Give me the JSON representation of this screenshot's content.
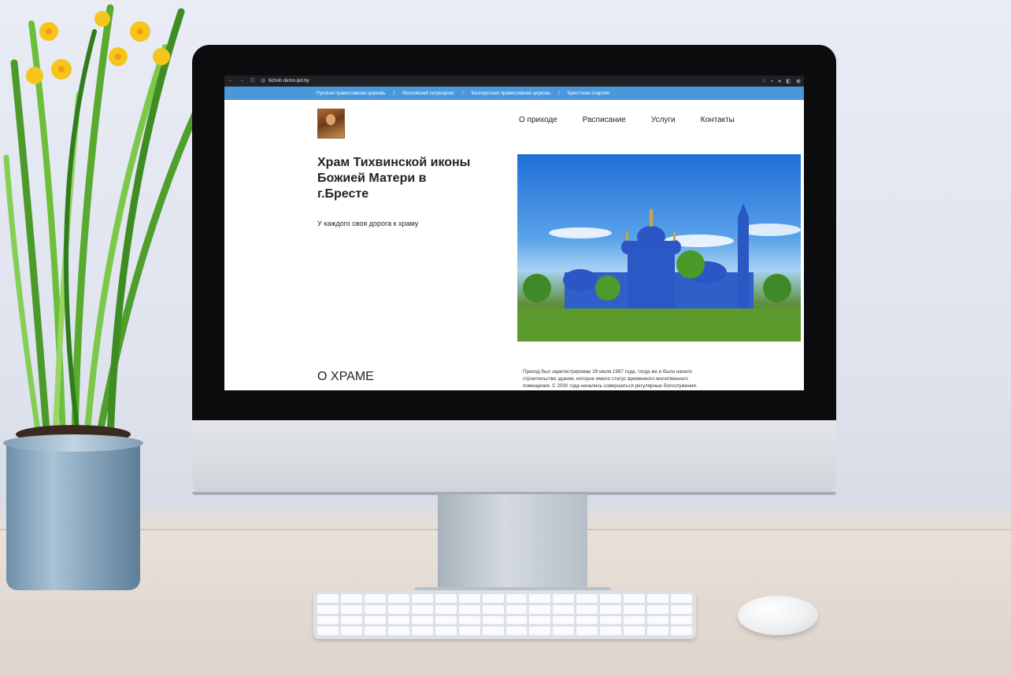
{
  "browser": {
    "url": "tichvin.demo.ipd.by",
    "nav": {
      "back": "←",
      "forward": "→",
      "reload": "C"
    }
  },
  "site": {
    "breadcrumbs": [
      "Русская православная церковь",
      "Московский патриархат",
      "Белорусская православная церковь",
      "Брестская епархия"
    ],
    "breadcrumb_separator": "/",
    "menu": [
      "О приходе",
      "Расписание",
      "Услуги",
      "Контакты"
    ],
    "title": "Храм Тихвинской иконы Божией Матери в г.Бресте",
    "subtitle": "У каждого своя дорога к храму",
    "about_heading": "О ХРАМЕ",
    "about_text": "Приход был зарегистрирован 29 июля 1997 года, тогда же и было начато строительство здания, которое имело статус временного молитвенного помещения. С 2000 года начались совершаться регулярные богослужения."
  },
  "colors": {
    "accent": "#4a97d9",
    "browser_bar": "#202124"
  }
}
